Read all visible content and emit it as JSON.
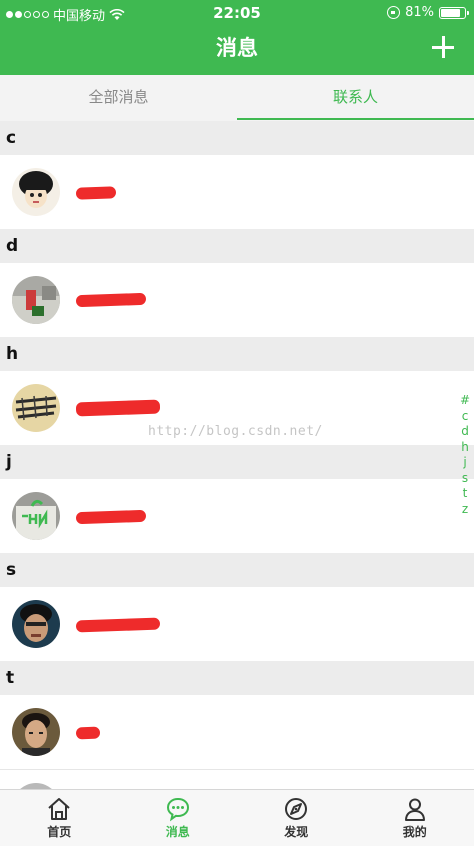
{
  "status_bar": {
    "carrier": "中国移动",
    "time": "22:05",
    "battery": "81%",
    "battery_level": 0.81
  },
  "header": {
    "title": "消息",
    "add_icon": "plus-icon",
    "background_color": "#3fb951"
  },
  "tabs": [
    {
      "label": "全部消息",
      "active": false
    },
    {
      "label": "联系人",
      "active": true
    }
  ],
  "sections": [
    {
      "letter": "c"
    },
    {
      "letter": "d"
    },
    {
      "letter": "h"
    },
    {
      "letter": "j"
    },
    {
      "letter": "s"
    },
    {
      "letter": "t"
    }
  ],
  "index_letters": [
    "#",
    "c",
    "d",
    "h",
    "j",
    "s",
    "t",
    "z"
  ],
  "watermark": "http://blog.csdn.net/",
  "tabbar": [
    {
      "label": "首页",
      "icon": "home-icon",
      "active": false
    },
    {
      "label": "消息",
      "icon": "chat-bubble-icon",
      "active": true
    },
    {
      "label": "发现",
      "icon": "compass-icon",
      "active": false
    },
    {
      "label": "我的",
      "icon": "person-icon",
      "active": false
    }
  ],
  "colors": {
    "accent": "#3fb951",
    "section_bg": "#ececec",
    "redaction": "#ee2b2b"
  }
}
